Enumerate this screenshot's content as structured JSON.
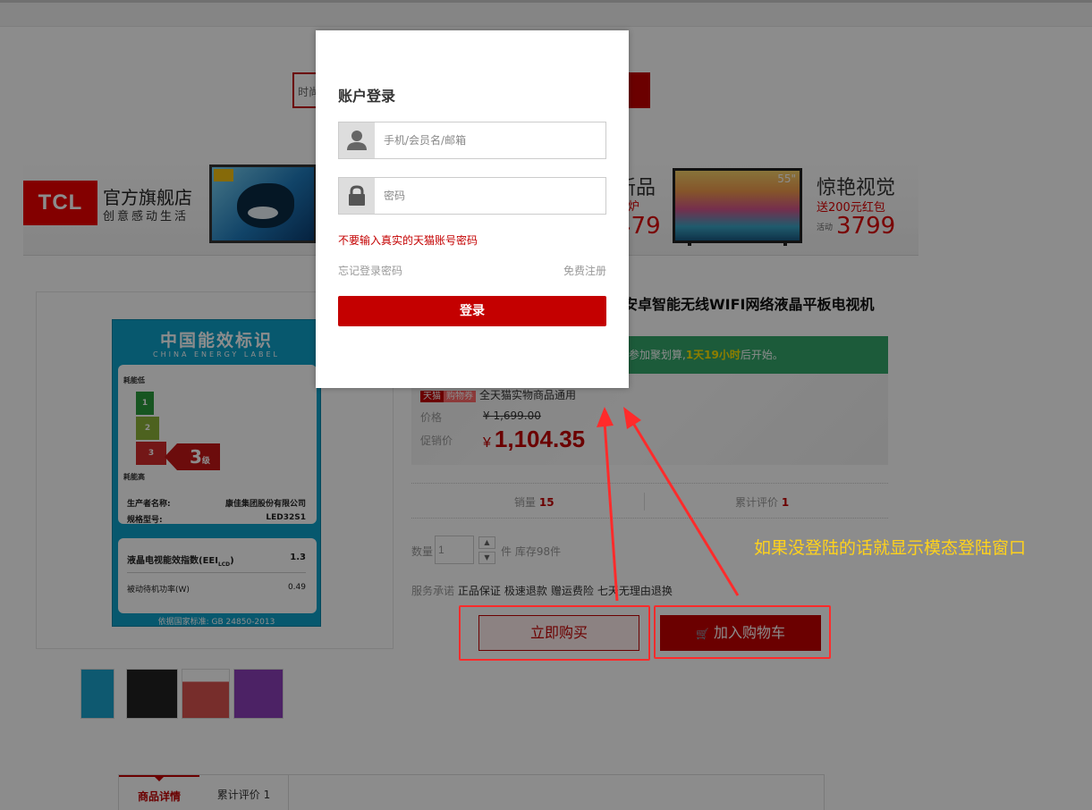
{
  "search": {
    "query_fragment": "时尚"
  },
  "banner": {
    "logo_text": "TCL",
    "store_name": "官方旗舰店",
    "slogan": "创意感动生活",
    "promo1_title": "新品",
    "promo1_sub": "盛炉",
    "promo1_price": "479",
    "promo2_title": "惊艳视觉",
    "promo2_sub": "送200元红包",
    "promo2_tag": "活动",
    "promo2_price": "3799",
    "tv_size": "55\""
  },
  "energy_label": {
    "title": "中国能效标识",
    "subtitle": "CHINA ENERGY LABEL",
    "low": "耗能低",
    "high": "耗能高",
    "levels": [
      "1",
      "2",
      "3"
    ],
    "grade": "3",
    "grade_suffix": "级",
    "maker_label": "生产者名称:",
    "maker": "康佳集团股份有限公司",
    "model_label": "规格型号:",
    "model": "LED32S1",
    "eei_label": "液晶电视能效指数(EEI",
    "eei_sub": "LCD",
    "eei_label_end": ")",
    "eei": "1.3",
    "standby_label": "被动待机功率(W)",
    "standby": "0.49",
    "standard": "依据国家标准: GB 24850-2013"
  },
  "product": {
    "title": "安卓智能无线WIFI网络液晶平板电视机",
    "green_bar_prefix": "参加聚划算,",
    "green_bar_time": "1天19小时",
    "green_bar_suffix": "后开始。",
    "coupon_tmall": "天猫",
    "coupon_gouwu": "购物券",
    "coupon_text": "全天猫实物商品通用",
    "price_label": "价格",
    "price_old": "¥ 1,699.00",
    "promo_label": "促销价",
    "currency": "¥",
    "promo_price": "1,104.35",
    "sales_label": "销量",
    "sales": "15",
    "reviews_label": "累计评价",
    "reviews": "1",
    "qty_label": "数量",
    "qty": "1",
    "stock": "件 库存98件",
    "service_label": "服务承诺",
    "services": [
      "正品保证",
      "极速退款",
      "赠运费险",
      "七天无理由退换"
    ],
    "buy_now": "立即购买",
    "add_cart": "加入购物车"
  },
  "tabs": [
    {
      "label": "商品详情"
    },
    {
      "label": "累计评价",
      "count": "1"
    }
  ],
  "modal": {
    "title": "账户登录",
    "username_placeholder": "手机/会员名/邮箱",
    "password_placeholder": "密码",
    "warning": "不要输入真实的天猫账号密码",
    "forgot": "忘记登录密码",
    "register": "免费注册",
    "login_button": "登录"
  },
  "annotation": {
    "text": "如果没登陆的话就显示模态登陆窗口",
    "color": "#ffd21c",
    "box_color": "#ff2b2b"
  },
  "colors": {
    "brand": "#c40000",
    "green": "#33a66a"
  }
}
